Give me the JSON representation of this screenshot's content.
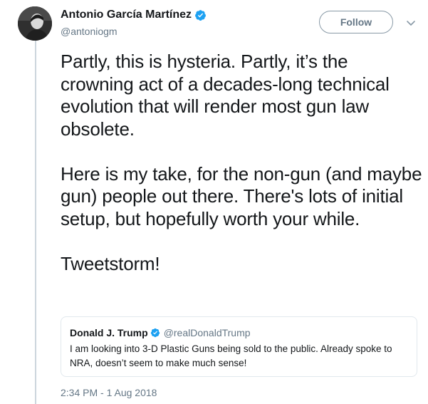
{
  "tweet": {
    "author": {
      "display_name": "Antonio García Martínez",
      "handle": "@antoniogm",
      "verified": true
    },
    "follow_label": "Follow",
    "paragraphs": [
      "Partly, this is hysteria. Partly, it’s the crowning act of a decades-long technical evolution that will render most gun law obsolete.",
      "Here is my take, for the non-gun (and maybe gun) people out there. There's lots of initial setup, but hopefully worth your while.",
      "Tweetstorm!"
    ],
    "timestamp": "2:34 PM - 1 Aug 2018"
  },
  "quote": {
    "display_name": "Donald J. Trump",
    "handle": "@realDonaldTrump",
    "verified": true,
    "text": "I am looking into 3-D Plastic Guns being sold to the public. Already spoke to NRA, doesn’t seem to make much sense!"
  },
  "colors": {
    "verified_blue": "#1da1f2",
    "secondary_text": "#657786",
    "thread_line": "#ccd6dd",
    "border": "#e1e8ed"
  },
  "icons": {
    "verified": "verified-badge-icon",
    "caret": "chevron-down-icon"
  }
}
